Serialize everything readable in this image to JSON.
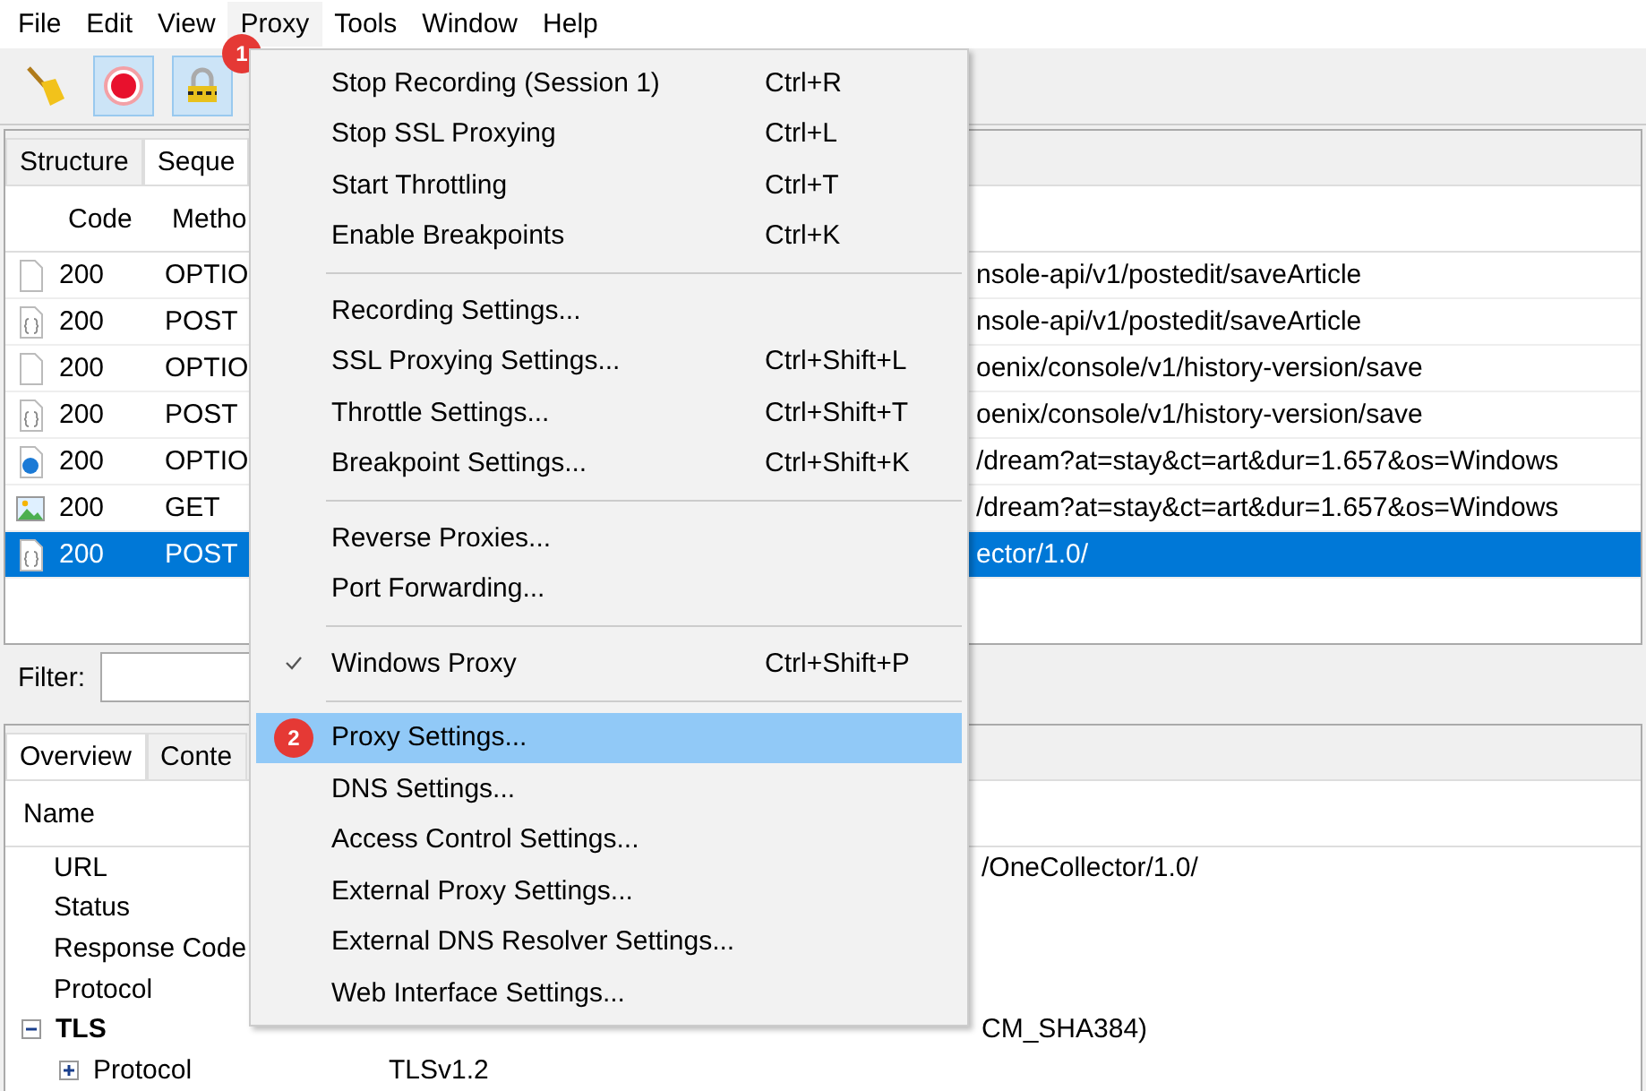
{
  "menu_bar": [
    {
      "label": "File",
      "selected": false
    },
    {
      "label": "Edit",
      "selected": false
    },
    {
      "label": "View",
      "selected": false
    },
    {
      "label": "Proxy",
      "selected": true
    },
    {
      "label": "Tools",
      "selected": false
    },
    {
      "label": "Window",
      "selected": false
    },
    {
      "label": "Help",
      "selected": false
    }
  ],
  "toolbar": {
    "record_pressed": true,
    "ssl_pressed": true,
    "badge": "1"
  },
  "upper_tabs": [
    {
      "label": "Structure",
      "selected": false
    },
    {
      "label": "Seque",
      "selected": true
    }
  ],
  "table": {
    "columns": [
      "Code",
      "Metho"
    ],
    "rows": [
      {
        "kind": "plain",
        "code": "200",
        "method": "OPTIO",
        "path": "nsole-api/v1/postedit/saveArticle",
        "selected": false
      },
      {
        "kind": "script",
        "code": "200",
        "method": "POST",
        "path": "nsole-api/v1/postedit/saveArticle",
        "selected": false
      },
      {
        "kind": "plain",
        "code": "200",
        "method": "OPTIO",
        "path": "oenix/console/v1/history-version/save",
        "selected": false
      },
      {
        "kind": "script",
        "code": "200",
        "method": "POST",
        "path": "oenix/console/v1/history-version/save",
        "selected": false
      },
      {
        "kind": "globe",
        "code": "200",
        "method": "OPTIO",
        "path": "/dream?at=stay&ct=art&dur=1.657&os=Windows",
        "selected": false
      },
      {
        "kind": "image",
        "code": "200",
        "method": "GET",
        "path": "/dream?at=stay&ct=art&dur=1.657&os=Windows",
        "selected": false
      },
      {
        "kind": "script",
        "code": "200",
        "method": "POST",
        "path": "ector/1.0/",
        "selected": true
      }
    ]
  },
  "filter": {
    "label": "Filter:"
  },
  "lower_tabs": [
    {
      "label": "Overview",
      "selected": true
    },
    {
      "label": "Conte",
      "selected": false
    }
  ],
  "overview": {
    "header": "Name",
    "rows": [
      {
        "name": "URL",
        "value": "/OneCollector/1.0/"
      },
      {
        "name": "Status"
      },
      {
        "name": "Response Code"
      },
      {
        "name": "Protocol"
      },
      {
        "name": "TLS",
        "value": "CM_SHA384)",
        "expanded": true,
        "children": [
          {
            "name": "Protocol",
            "value": "TLSv1.2",
            "expanded": false
          }
        ]
      }
    ]
  },
  "proxy_menu": {
    "groups": [
      [
        {
          "label": "Stop Recording (Session 1)",
          "shortcut": "Ctrl+R",
          "checked": false,
          "selected": false
        },
        {
          "label": "Stop SSL Proxying",
          "shortcut": "Ctrl+L",
          "checked": false,
          "selected": false
        },
        {
          "label": "Start Throttling",
          "shortcut": "Ctrl+T",
          "checked": false,
          "selected": false
        },
        {
          "label": "Enable Breakpoints",
          "shortcut": "Ctrl+K",
          "checked": false,
          "selected": false
        }
      ],
      [
        {
          "label": "Recording Settings...",
          "checked": false,
          "selected": false
        },
        {
          "label": "SSL Proxying Settings...",
          "shortcut": "Ctrl+Shift+L",
          "checked": false,
          "selected": false
        },
        {
          "label": "Throttle Settings...",
          "shortcut": "Ctrl+Shift+T",
          "checked": false,
          "selected": false
        },
        {
          "label": "Breakpoint Settings...",
          "shortcut": "Ctrl+Shift+K",
          "checked": false,
          "selected": false
        }
      ],
      [
        {
          "label": "Reverse Proxies...",
          "checked": false,
          "selected": false
        },
        {
          "label": "Port Forwarding...",
          "checked": false,
          "selected": false
        }
      ],
      [
        {
          "label": "Windows Proxy",
          "shortcut": "Ctrl+Shift+P",
          "checked": true,
          "selected": false
        }
      ],
      [
        {
          "label": "Proxy Settings...",
          "checked": false,
          "selected": true,
          "badge": "2"
        },
        {
          "label": "DNS Settings...",
          "checked": false,
          "selected": false
        },
        {
          "label": "Access Control Settings...",
          "checked": false,
          "selected": false
        },
        {
          "label": "External Proxy Settings...",
          "checked": false,
          "selected": false
        },
        {
          "label": "External DNS Resolver Settings...",
          "checked": false,
          "selected": false
        },
        {
          "label": "Web Interface Settings...",
          "checked": false,
          "selected": false
        }
      ]
    ]
  }
}
